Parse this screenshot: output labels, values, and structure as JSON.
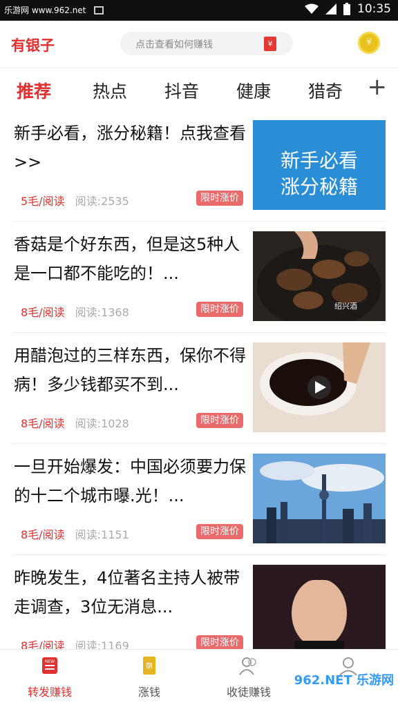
{
  "status_bar": {
    "watermark": "乐游网 www.962.net",
    "time": "10:35"
  },
  "header": {
    "brand": "有银子",
    "search_placeholder": "点击查看如何赚钱",
    "coin_symbol": "¥"
  },
  "tabs": [
    "推荐",
    "热点",
    "抖音",
    "健康",
    "猎奇"
  ],
  "tabs_add": "+",
  "feed": [
    {
      "title": "新手必看，涨分秘籍！点我查看>>",
      "price": "5毛/阅读",
      "reads": "阅读:2535",
      "badge": "限时涨价",
      "thumb_text_1": "新手必看",
      "thumb_text_2": "涨分秘籍"
    },
    {
      "title": "香菇是个好东西，但是这5种人是一口都不能吃的！...",
      "price": "8毛/阅读",
      "reads": "阅读:1368",
      "badge": "限时涨价",
      "thumb_caption": "绍兴酒"
    },
    {
      "title": "用醋泡过的三样东西，保你不得病！多少钱都买不到...",
      "price": "8毛/阅读",
      "reads": "阅读:1028",
      "badge": "限时涨价"
    },
    {
      "title": "一旦开始爆发：中国必须要力保的十二个城市曝.光！...",
      "price": "8毛/阅读",
      "reads": "阅读:1151",
      "badge": "限时涨价"
    },
    {
      "title": "昨晚发生，4位著名主持人被带走调查，3位无消息...",
      "price": "8毛/阅读",
      "reads": "阅读:1169",
      "badge": "限时涨价"
    }
  ],
  "bottom_nav": [
    {
      "label": "转发赚钱",
      "icon": "news-icon",
      "icon_text": "NEW"
    },
    {
      "label": "涨钱",
      "icon": "money-scroll-icon",
      "icon_text": "荫"
    },
    {
      "label": "收徒赚钱",
      "icon": "users-icon"
    },
    {
      "label": "",
      "icon": "profile-icon"
    }
  ],
  "watermark_brand": "962.NET 乐游网",
  "colors": {
    "accent": "#e03131",
    "badge": "#e86a6a",
    "thumb_blue": "#2a8ed6"
  }
}
